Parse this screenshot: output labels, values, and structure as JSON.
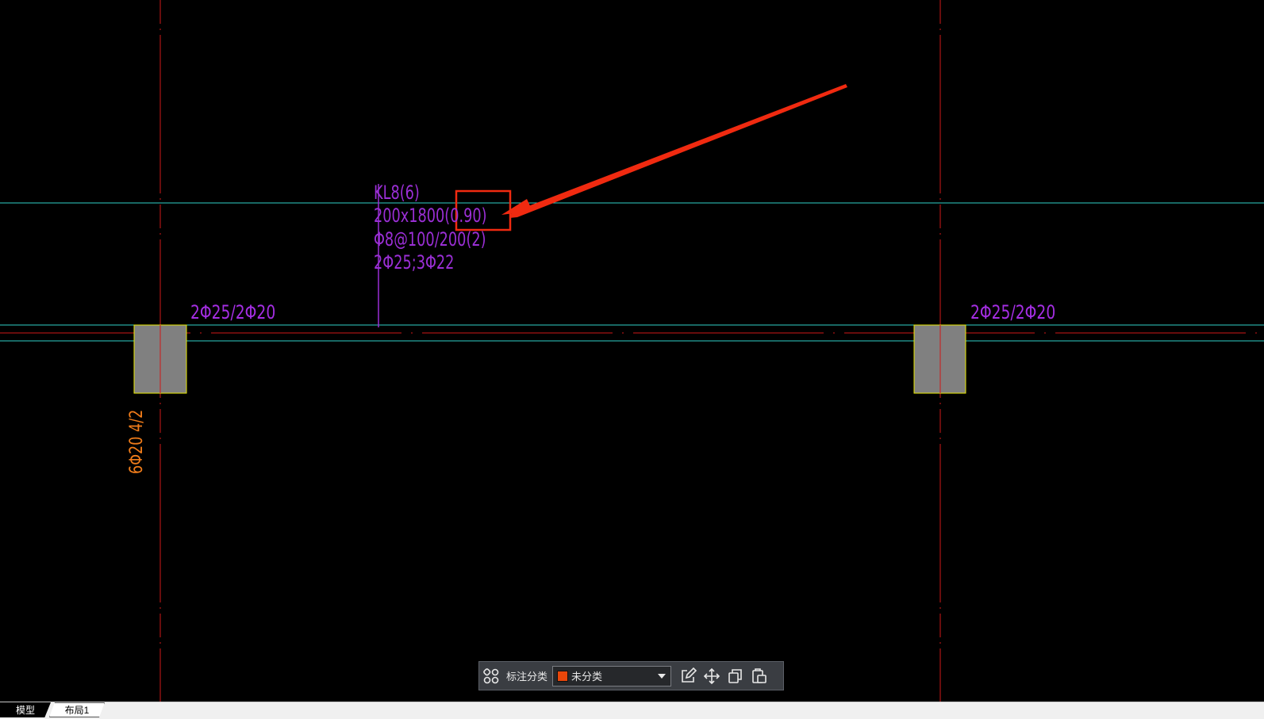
{
  "drawing": {
    "beam_label": {
      "line1": "KL8(6)",
      "line2": "200x1800(0.90)",
      "line3": "Φ8@100/200(2)",
      "line4": "2Φ25;3Φ22"
    },
    "left_support_rebar": "2Φ25/2Φ20",
    "right_support_rebar": "2Φ25/2Φ20",
    "column_rebar_vertical": "6Φ20 4/2",
    "colors": {
      "axis_red": "#d01818",
      "beam_cyan": "#2fd0c8",
      "beam_label_purple": "#9b2fd6",
      "column_fill": "#808080",
      "column_border": "#e8e800",
      "annotation_red": "#f02a10",
      "column_text_orange": "#f07c1a"
    }
  },
  "toolbar": {
    "grid_icon": "grid-icon",
    "label": "标注分类",
    "category_value": "未分类",
    "category_color": "#e8460a",
    "icons": [
      "edit-icon",
      "move-icon",
      "copy-icon",
      "paste-icon"
    ]
  },
  "tabs": {
    "model": "模型",
    "layout1": "布局1"
  }
}
